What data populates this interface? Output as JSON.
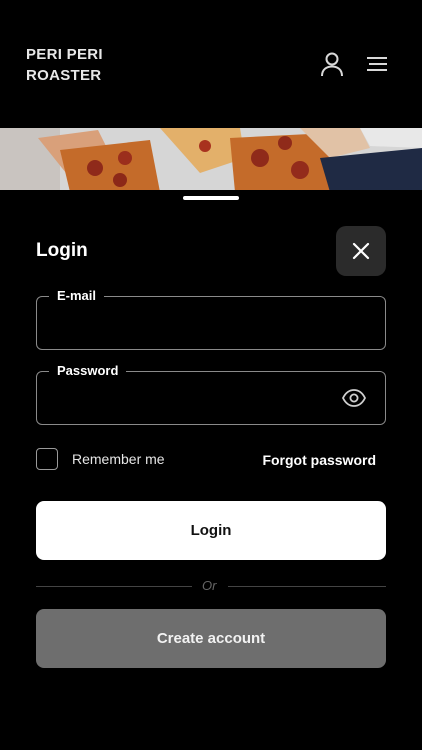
{
  "brand": {
    "line1": "PERI PERI",
    "line2": "ROASTER"
  },
  "icons": {
    "user": "user-icon",
    "menu": "hamburger-menu-icon",
    "close": "close-icon",
    "eye": "eye-icon"
  },
  "login_sheet": {
    "title": "Login",
    "email": {
      "label": "E-mail",
      "value": "",
      "placeholder": ""
    },
    "password": {
      "label": "Password",
      "value": "",
      "placeholder": ""
    },
    "remember_label": "Remember me",
    "remember_checked": false,
    "forgot_label": "Forgot password",
    "login_label": "Login",
    "divider_text": "Or",
    "create_account_label": "Create account"
  },
  "colors": {
    "background": "#000000",
    "primary_button": "#ffffff",
    "secondary_button": "#6e6e6e",
    "close_button": "#2b2b2b"
  }
}
